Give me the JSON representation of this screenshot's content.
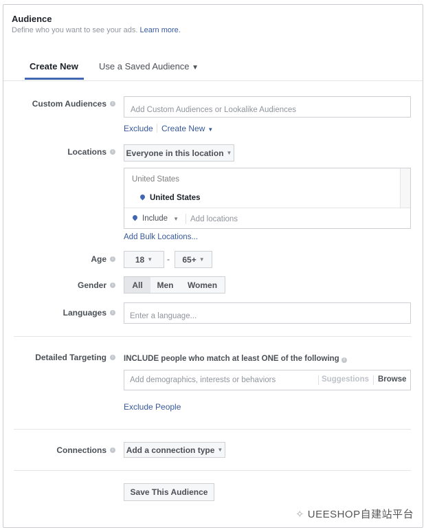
{
  "header": {
    "title": "Audience",
    "subtitle": "Define who you want to see your ads.",
    "learn_more": "Learn more."
  },
  "tabs": [
    {
      "label": "Create New",
      "active": true
    },
    {
      "label": "Use a Saved Audience"
    }
  ],
  "custom_audiences": {
    "label": "Custom Audiences",
    "placeholder": "Add Custom Audiences or Lookalike Audiences",
    "exclude": "Exclude",
    "create_new": "Create New"
  },
  "locations": {
    "label": "Locations",
    "type": "Everyone in this location",
    "group": "United States",
    "selected": "United States",
    "include": "Include",
    "placeholder": "Add locations",
    "bulk": "Add Bulk Locations..."
  },
  "age": {
    "label": "Age",
    "min": "18",
    "sep": "-",
    "max": "65+"
  },
  "gender": {
    "label": "Gender",
    "options": [
      "All",
      "Men",
      "Women"
    ],
    "selected": "All"
  },
  "languages": {
    "label": "Languages",
    "placeholder": "Enter a language..."
  },
  "detailed": {
    "label": "Detailed Targeting",
    "include_text": "INCLUDE people who match at least ONE of the following",
    "placeholder": "Add demographics, interests or behaviors",
    "suggestions": "Suggestions",
    "browse": "Browse",
    "exclude": "Exclude People"
  },
  "connections": {
    "label": "Connections",
    "button": "Add a connection type"
  },
  "save": "Save This Audience",
  "watermark": "UEESHOP自建站平台",
  "colors": {
    "link": "#365899",
    "tab_underline": "#4267b2"
  }
}
